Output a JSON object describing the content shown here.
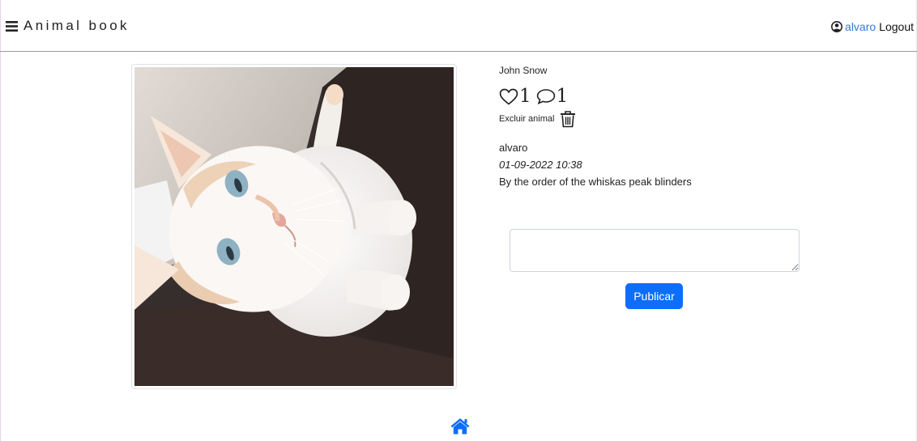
{
  "navbar": {
    "menu_icon": "hamburger-menu-icon",
    "brand": "Animal book",
    "user_icon": "user-circle-icon",
    "username": "alvaro",
    "logout": "Logout"
  },
  "post": {
    "photo_alt": "Cat",
    "author": "John Snow",
    "likes": "1",
    "comments_count": "1",
    "delete_label": "Excluir animal",
    "like_icon": "heart-outline-icon",
    "comment_icon": "speech-bubble-icon",
    "delete_icon": "trash-icon"
  },
  "comments": [
    {
      "user": "alvaro",
      "date": "01-09-2022 10:38",
      "text": "By the order of the whiskas peak blinders"
    }
  ],
  "comment_form": {
    "placeholder": "",
    "submit_label": "Publicar"
  },
  "footer": {
    "home_icon": "home-icon"
  },
  "colors": {
    "primary": "#0d6efd",
    "link": "#2f7bd8",
    "divider": "#9a9a9a"
  }
}
